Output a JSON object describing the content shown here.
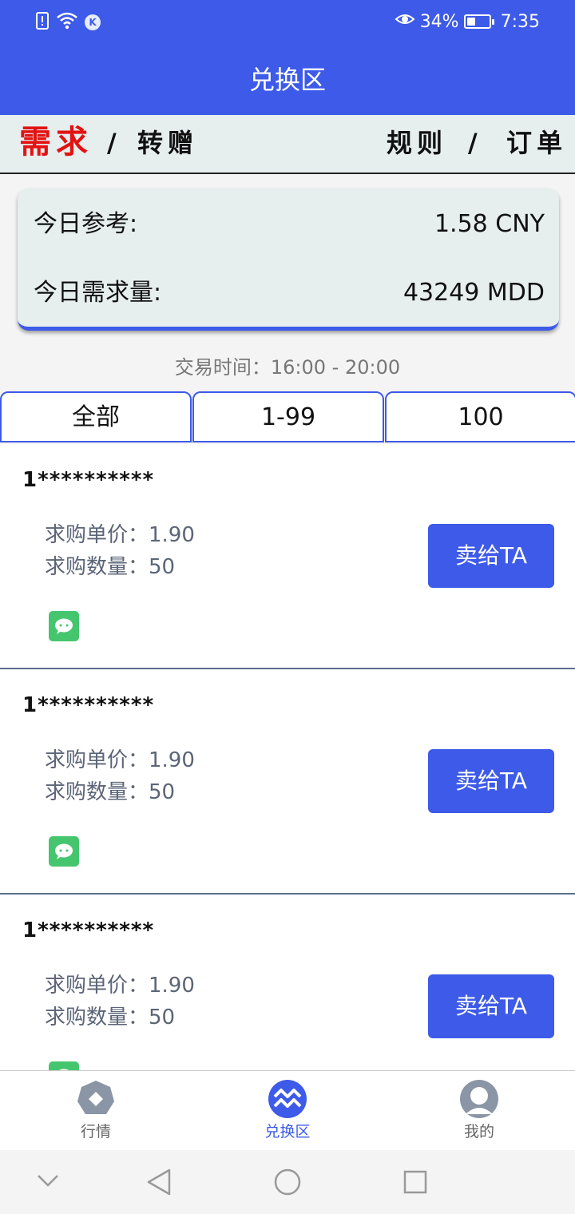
{
  "status": {
    "battery_percent": "34%",
    "battery_level": 0.34,
    "time": "7:35",
    "left_icons": [
      "sim-alert-icon",
      "wifi-icon",
      "k-app-icon"
    ],
    "k_badge": "K"
  },
  "header": {
    "title": "兑换区"
  },
  "subnav": {
    "demand": "需求",
    "slash": "/",
    "gift": "转赠",
    "rules": "规则",
    "orders": "订单"
  },
  "summary": {
    "ref_label": "今日参考:",
    "ref_value": "1.58 CNY",
    "demand_label": "今日需求量:",
    "demand_value": "43249 MDD"
  },
  "trade_time": "交易时间：16:00 - 20:00",
  "tabs": [
    {
      "label": "全部",
      "active": true
    },
    {
      "label": "1-99",
      "active": false
    },
    {
      "label": "100",
      "active": false
    }
  ],
  "listings": [
    {
      "user": "1**********",
      "price": "求购单价：1.90",
      "qty": "求购数量：50",
      "button": "卖给TA"
    },
    {
      "user": "1**********",
      "price": "求购单价：1.90",
      "qty": "求购数量：50",
      "button": "卖给TA"
    },
    {
      "user": "1**********",
      "price": "求购单价：1.90",
      "qty": "求购数量：50",
      "button": "卖给TA"
    }
  ],
  "bottom_nav": [
    {
      "label": "行情",
      "icon": "market-icon",
      "active": false
    },
    {
      "label": "兑换区",
      "icon": "exchange-icon",
      "active": true
    },
    {
      "label": "我的",
      "icon": "profile-icon",
      "active": false
    }
  ],
  "colors": {
    "primary": "#3d5ae8",
    "demand_red": "#e31212",
    "wechat_green": "#45c66e"
  }
}
